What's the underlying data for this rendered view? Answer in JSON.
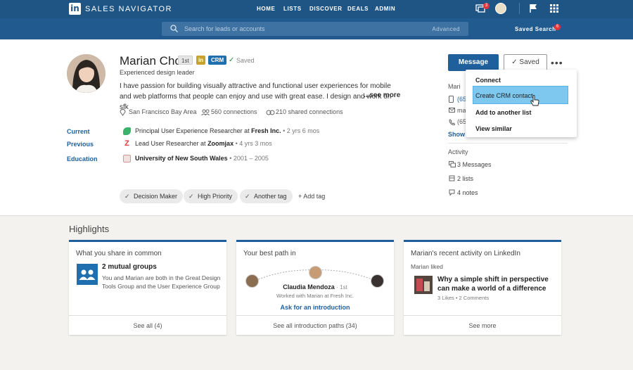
{
  "app": {
    "logo": "in",
    "title": "SALES NAVIGATOR"
  },
  "nav": [
    "HOME",
    "LISTS",
    "DISCOVER",
    "DEALS",
    "ADMIN"
  ],
  "topbar": {
    "notifications_count": "3",
    "saved_search_count": "6"
  },
  "search": {
    "placeholder": "Search for leads or accounts",
    "advanced": "Advanced",
    "saved_search": "Saved Search"
  },
  "profile": {
    "name": "Marian Cho",
    "degree": "1st",
    "linkedin_badge": "in",
    "crm": "CRM",
    "saved_status": "Saved",
    "headline": "Experienced design leader",
    "summary": "I have passion for building visually attractive and functional user experiences for mobile and web platforms that people can enjoy and use with great ease. I design and work on sfk",
    "see_more": "...see more",
    "location": "San Francisco Bay Area",
    "connections": "560 connections",
    "shared_connections": "210 shared connections",
    "current_label": "Current",
    "current_title": "Principal User Experience Researcher at ",
    "current_company": "Fresh Inc.",
    "current_duration": " • 2 yrs 6 mos",
    "previous_label": "Previous",
    "previous_title": "Lead User Researcher at ",
    "previous_company": "Zoomjax",
    "previous_duration": " • 4 yrs 3 mos",
    "education_label": "Education",
    "education_school": "University of New South Wales",
    "education_years": " • 2001 – 2005",
    "tags": [
      "Decision Maker",
      "High Priority",
      "Another tag"
    ],
    "add_tag": "Add tag"
  },
  "actions": {
    "message": "Message",
    "saved": "Saved",
    "more": "•••"
  },
  "contact": {
    "label": "Mari",
    "phone1": "(65",
    "email": "ma",
    "phone2": "(65",
    "show": "Show"
  },
  "dropdown": [
    "Connect",
    "Create CRM contact",
    "Add to another list",
    "View similar"
  ],
  "activity": {
    "label": "Activity",
    "messages": "3 Messages",
    "lists": "2 lists",
    "notes": "4 notes"
  },
  "highlights": {
    "title": "Highlights",
    "card1": {
      "title": "What you share in common",
      "heading": "2 mutual groups",
      "body": "You and Marian are both in the Great Design Tools Group and the User Experience Group",
      "footer": "See all (4)"
    },
    "card2": {
      "title": "Your best path in",
      "name": "Claudia Mendoza",
      "degree": "· 1st",
      "sub": "Worked with Marian at Fresh Inc.",
      "cta": "Ask for an introduction",
      "footer": "See all introduction paths  (34)"
    },
    "card3": {
      "title": "Marian's recent activity on LinkedIn",
      "liked": "Marian liked",
      "article": "Why a simple shift in perspective can make a world of a difference",
      "stats": "3 Likes  •  2 Comments",
      "footer": "See more"
    }
  },
  "colors": {
    "brand": "#1f5585",
    "accent": "#1f5f9b",
    "highlight": "#7ec8f0"
  }
}
